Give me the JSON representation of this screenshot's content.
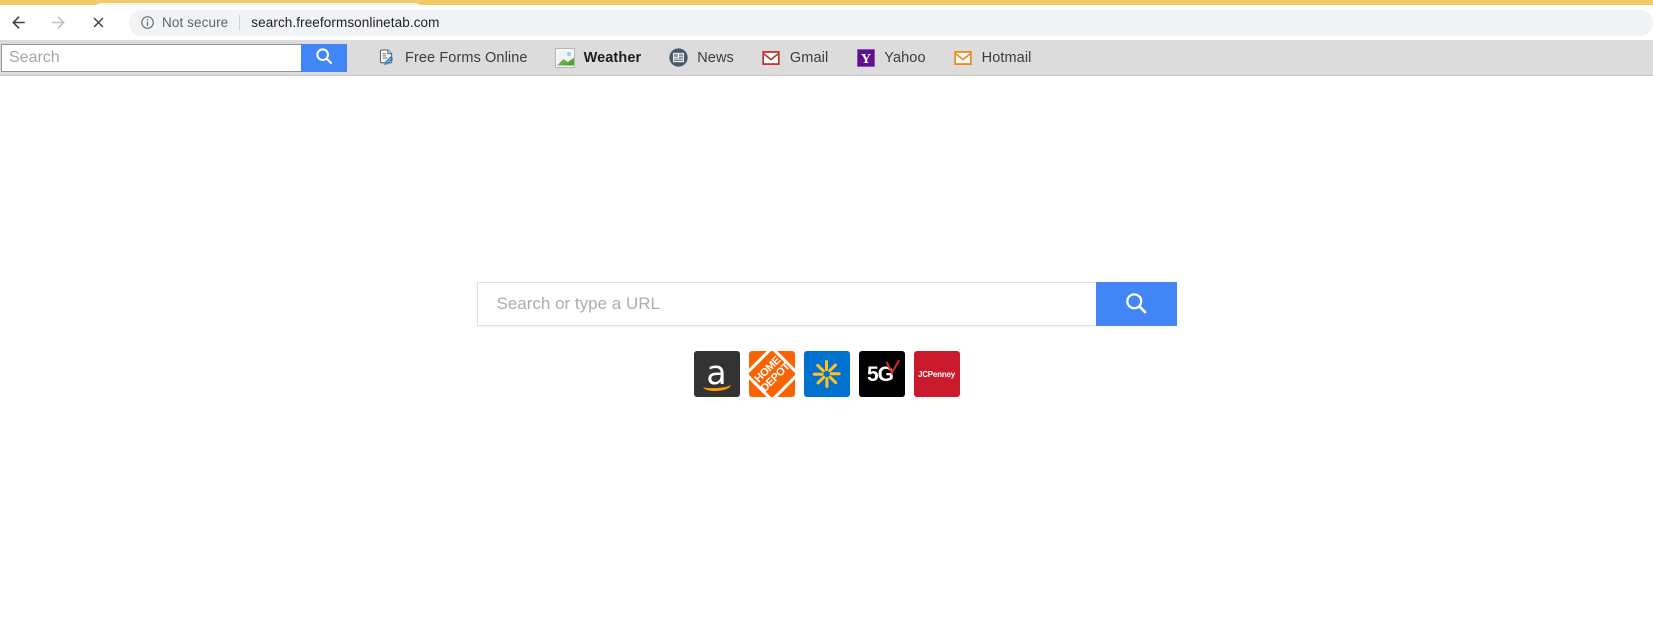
{
  "browser": {
    "nav": {
      "back_label": "Back",
      "forward_label": "Forward",
      "stop_label": "Stop"
    },
    "omnibox": {
      "security_icon": "info-circle-icon",
      "security_label": "Not secure",
      "url": "search.freeformsonlinetab.com"
    }
  },
  "toolbar": {
    "search": {
      "value": "",
      "placeholder": "Search",
      "button_icon": "search-icon",
      "button_color": "#4285f4"
    },
    "bookmarks": [
      {
        "label": "Free Forms Online",
        "icon": "document-edit-icon",
        "bold": false
      },
      {
        "label": "Weather",
        "icon": "broken-image-icon",
        "bold": true
      },
      {
        "label": "News",
        "icon": "newspaper-icon",
        "bold": false
      },
      {
        "label": "Gmail",
        "icon": "gmail-envelope-icon",
        "bold": false
      },
      {
        "label": "Yahoo",
        "icon": "yahoo-y-icon",
        "bold": false
      },
      {
        "label": "Hotmail",
        "icon": "hotmail-envelope-icon",
        "bold": false
      }
    ]
  },
  "page": {
    "search": {
      "value": "",
      "placeholder": "Search or type a URL",
      "button_icon": "search-icon",
      "button_color": "#4285f4"
    },
    "shortcuts": [
      {
        "name": "Amazon",
        "icon": "amazon-logo-icon",
        "bg": "#333333",
        "text": "a"
      },
      {
        "name": "Home Depot",
        "icon": "home-depot-logo-icon",
        "bg": "#f96302",
        "line1": "HOME",
        "line2": "DEPOT"
      },
      {
        "name": "Walmart",
        "icon": "walmart-spark-icon",
        "bg": "#0071ce"
      },
      {
        "name": "5G",
        "icon": "verizon-5g-icon",
        "bg": "#000000",
        "text": "5G"
      },
      {
        "name": "JCPenney",
        "icon": "jcpenney-logo-icon",
        "bg": "#ca1a2c",
        "text": "JCPenney"
      }
    ]
  }
}
